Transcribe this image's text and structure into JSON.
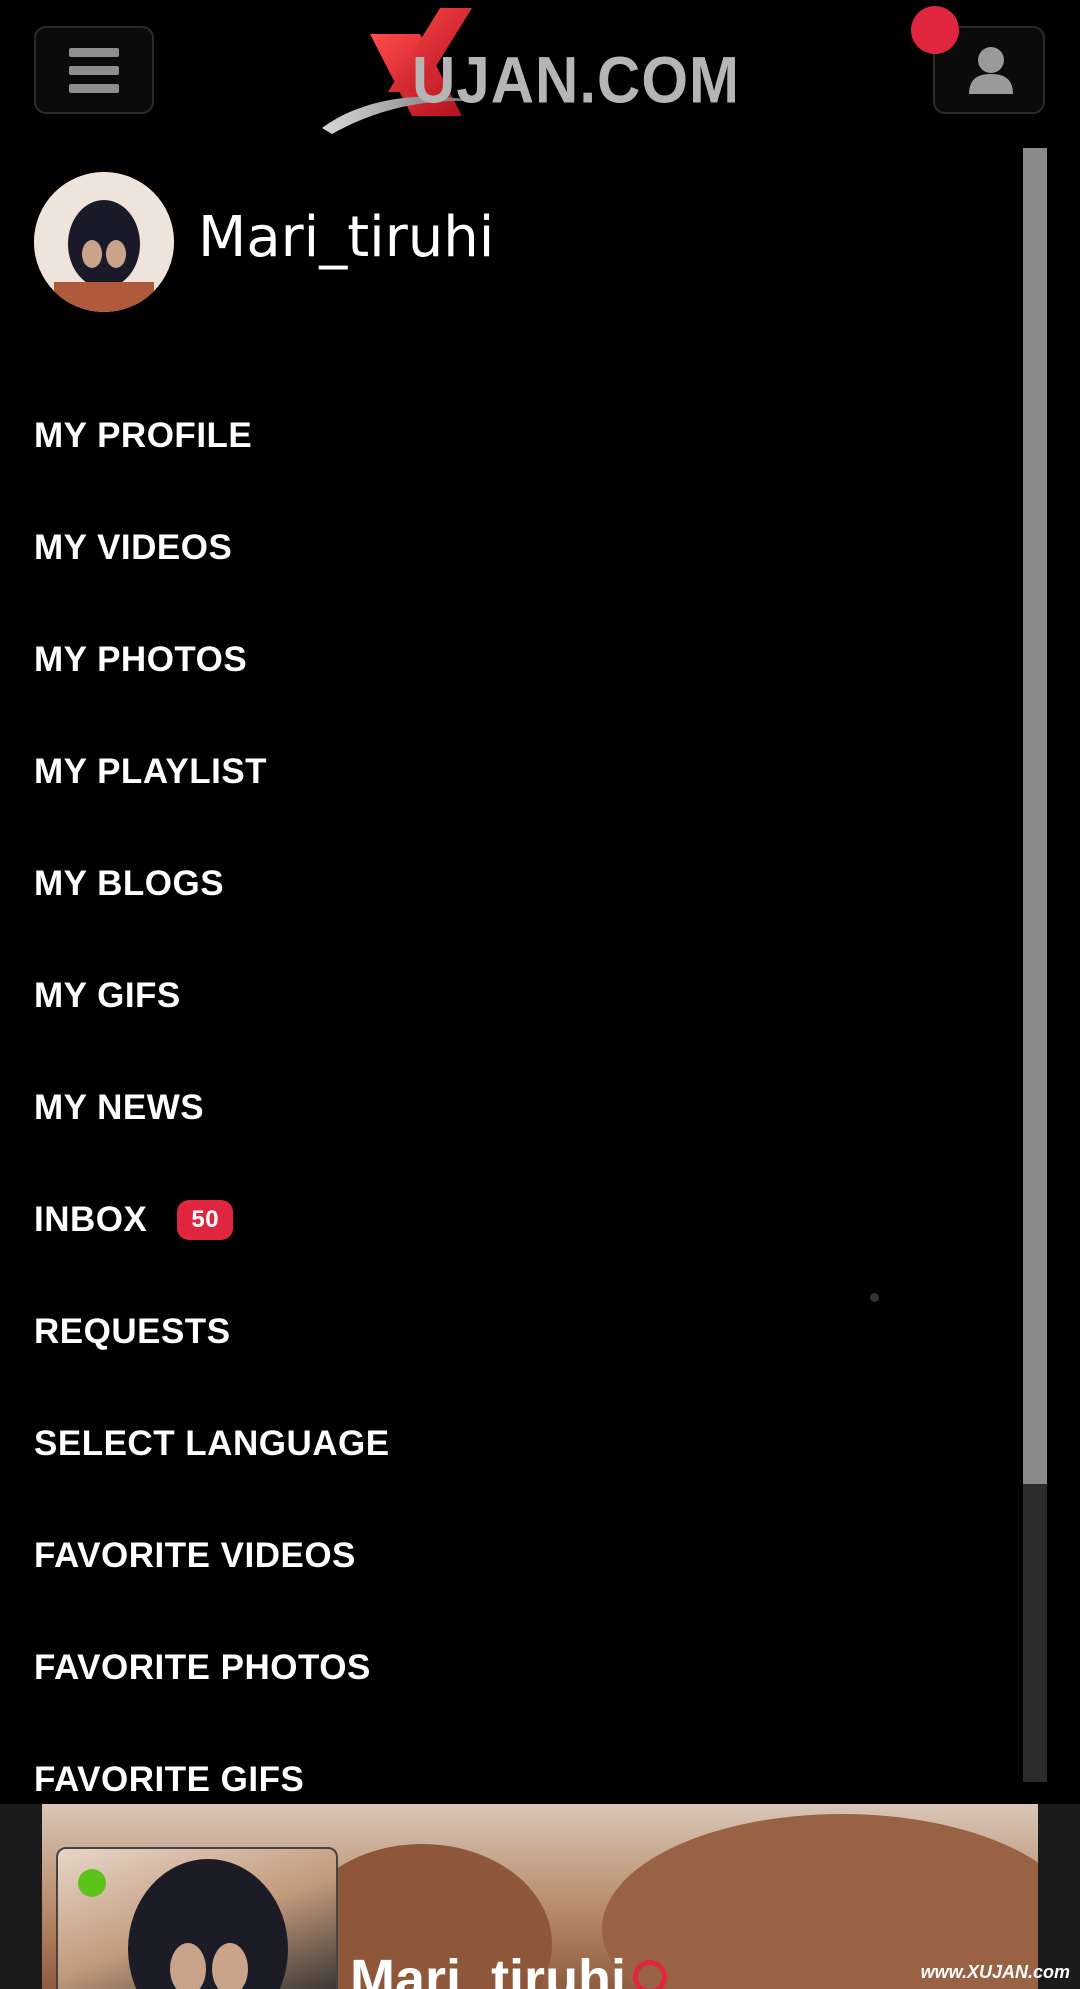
{
  "header": {
    "logo_text": "UJAN.COM",
    "logo_letter": "X"
  },
  "profile": {
    "username": "Mari_tiruhi"
  },
  "menu": {
    "items": [
      {
        "label": "MY PROFILE"
      },
      {
        "label": "MY VIDEOS"
      },
      {
        "label": "MY PHOTOS"
      },
      {
        "label": "MY PLAYLIST"
      },
      {
        "label": "MY BLOGS"
      },
      {
        "label": "MY GIFS"
      },
      {
        "label": "MY NEWS"
      },
      {
        "label": "INBOX",
        "badge": "50"
      },
      {
        "label": "REQUESTS"
      },
      {
        "label": "SELECT LANGUAGE"
      },
      {
        "label": "FAVORITE VIDEOS"
      },
      {
        "label": "FAVORITE PHOTOS"
      },
      {
        "label": "FAVORITE GIFS"
      }
    ]
  },
  "preview": {
    "name": "Mari_tiruhi"
  },
  "watermark": "www.XUJAN.com",
  "colors": {
    "accent": "#e0263e",
    "online": "#5dc21a",
    "background": "#000000",
    "scroll_thumb": "#8a8a8a"
  },
  "icons": {
    "menu": "hamburger-icon",
    "user": "user-icon",
    "location": "location-pin-icon"
  }
}
